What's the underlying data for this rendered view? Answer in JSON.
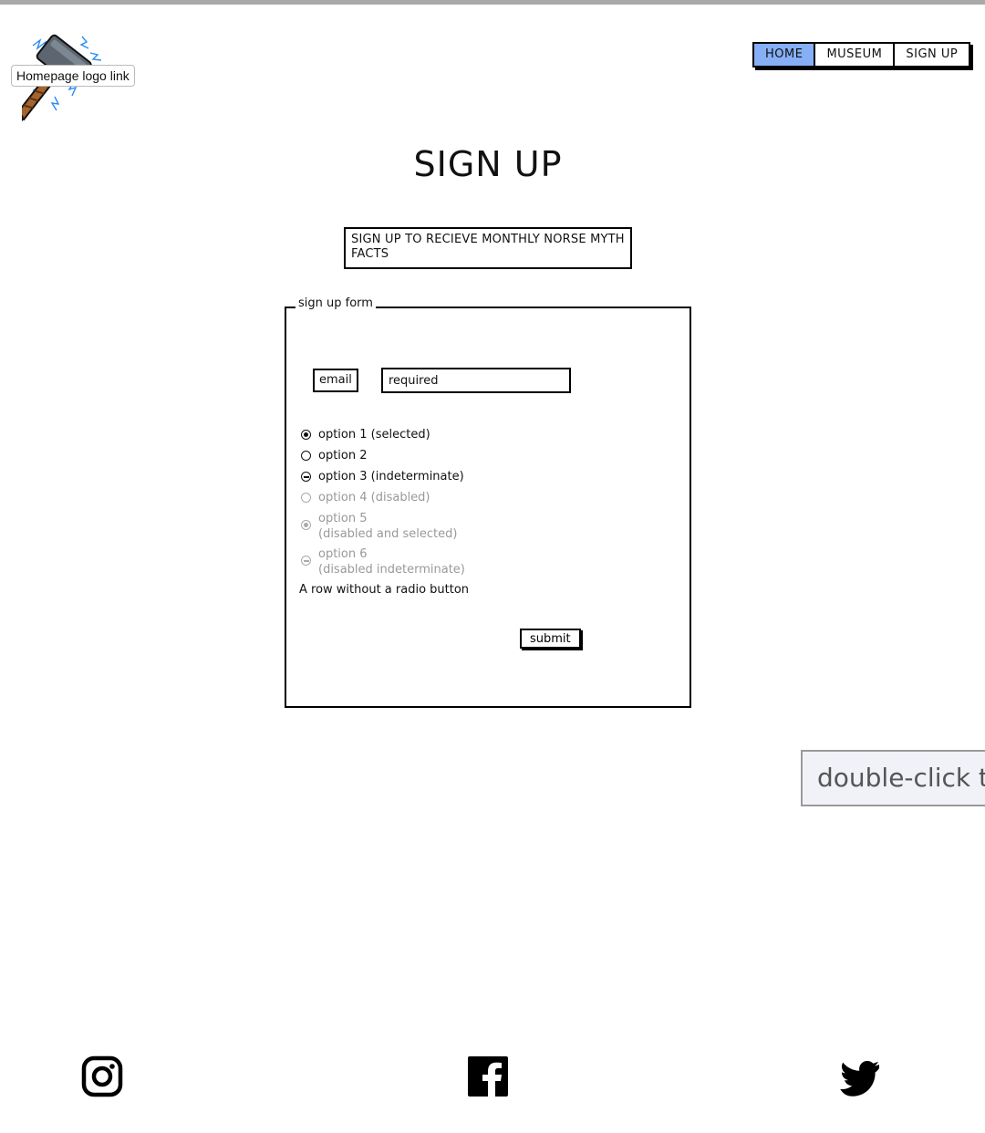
{
  "logo": {
    "tooltip": "Homepage logo link",
    "icon": "hammer-icon"
  },
  "nav": {
    "items": [
      {
        "label": "HOME",
        "active": true
      },
      {
        "label": "MUSEUM",
        "active": false
      },
      {
        "label": "SIGN UP",
        "active": false
      }
    ],
    "active_color": "#86aff5"
  },
  "page": {
    "title": "SIGN UP"
  },
  "promo": {
    "text": "SIGN UP TO RECIEVE MONTHLY NORSE MYTH FACTS"
  },
  "form": {
    "legend": "sign up form",
    "email_label": "email",
    "email_placeholder": "required",
    "radios": [
      {
        "label": "option 1 (selected)",
        "state": "selected",
        "disabled": false
      },
      {
        "label": "option 2",
        "state": "unselected",
        "disabled": false
      },
      {
        "label": "option 3 (indeterminate)",
        "state": "indeterminate",
        "disabled": false
      },
      {
        "label": "option 4 (disabled)",
        "state": "unselected",
        "disabled": true
      },
      {
        "label": "option 5",
        "sublabel": "(disabled and selected)",
        "state": "selected",
        "disabled": true
      },
      {
        "label": "option 6",
        "sublabel": "(disabled indeterminate)",
        "state": "indeterminate",
        "disabled": true
      }
    ],
    "plain_row": "A row without a radio button",
    "submit_label": "submit"
  },
  "hint": {
    "text": "double-click to edit"
  },
  "social": {
    "icons": [
      "instagram-icon",
      "facebook-icon",
      "twitter-icon"
    ]
  }
}
